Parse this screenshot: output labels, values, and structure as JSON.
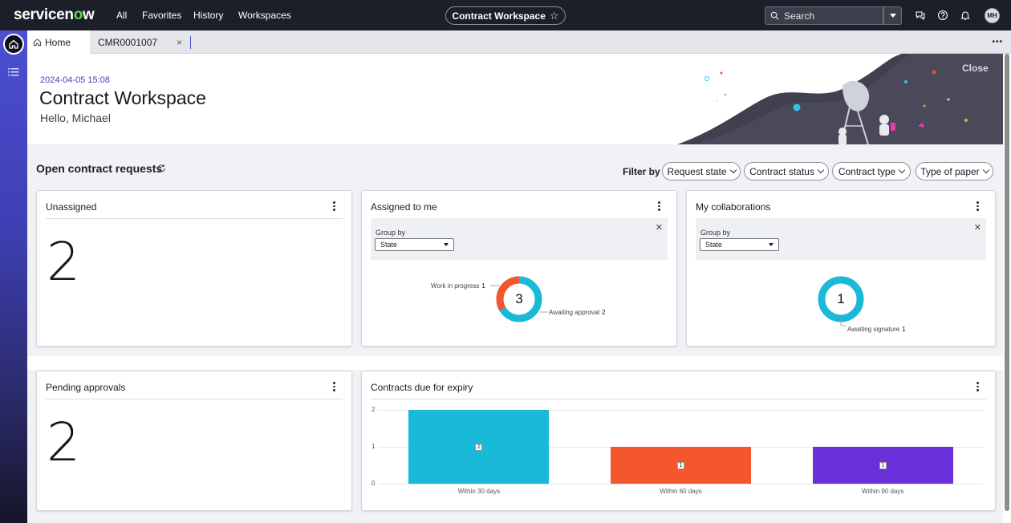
{
  "topnav": {
    "logo": "servicenow",
    "items": [
      "All",
      "Favorites",
      "History",
      "Workspaces"
    ],
    "workspace_pill": "Contract Workspace",
    "search_label": "Search",
    "avatar_initials": "MH"
  },
  "tabs": {
    "home_label": "Home",
    "record_label": "CMR0001007",
    "close_glyph": "×",
    "more_glyph": "•••"
  },
  "hero": {
    "date": "2024-04-05 15:08",
    "title": "Contract Workspace",
    "greeting": "Hello, Michael",
    "close_label": "Close"
  },
  "section": {
    "title": "Open contract requests",
    "filter_label": "Filter by",
    "filters": [
      "Request state",
      "Contract status",
      "Contract type",
      "Type of paper"
    ]
  },
  "cards": {
    "unassigned": {
      "title": "Unassigned",
      "value": "2"
    },
    "assigned": {
      "title": "Assigned to me",
      "group_by_label": "Group by",
      "group_by_value": "State",
      "total": "3",
      "segments": [
        {
          "label": "Work in progress",
          "value": 1,
          "color": "#f4572e"
        },
        {
          "label": "Awaiting approval",
          "value": 2,
          "color": "#1bb9d8"
        }
      ]
    },
    "collaborations": {
      "title": "My collaborations",
      "group_by_label": "Group by",
      "group_by_value": "State",
      "total": "1",
      "segments": [
        {
          "label": "Awaiting signature",
          "value": 1,
          "color": "#1bb9d8"
        }
      ]
    },
    "pending": {
      "title": "Pending approvals",
      "value": "2"
    },
    "expiry": {
      "title": "Contracts due for expiry"
    }
  },
  "chart_data": {
    "type": "bar",
    "categories": [
      "Within 30 days",
      "Within 60 days",
      "Within 90 days"
    ],
    "values": [
      2,
      1,
      1
    ],
    "colors": [
      "#1bb9d8",
      "#f4572e",
      "#6b31d8"
    ],
    "yticks": [
      "0",
      "1",
      "2"
    ],
    "ylim": [
      0,
      2
    ]
  }
}
